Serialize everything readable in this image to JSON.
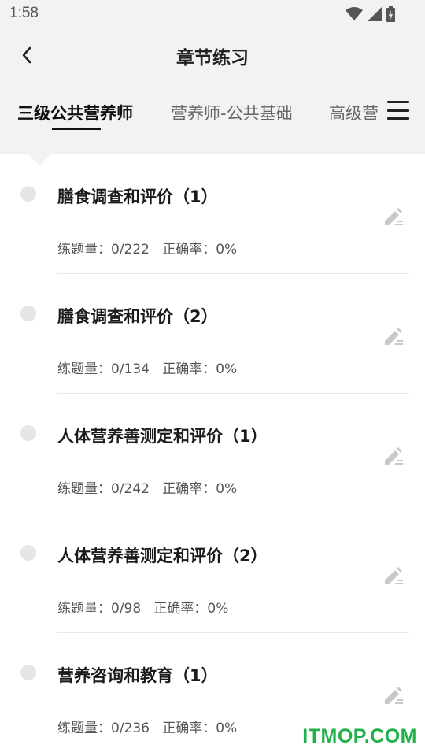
{
  "status_bar": {
    "time": "1:58"
  },
  "header": {
    "title": "章节练习"
  },
  "tabs": [
    {
      "label": "三级公共营养师",
      "active": true
    },
    {
      "label": "营养师-公共基础",
      "active": false
    },
    {
      "label": "高级营养师",
      "active": false
    }
  ],
  "stat_labels": {
    "count": "练题量：",
    "accuracy": "正确率："
  },
  "chapters": [
    {
      "title": "膳食调查和评价（1）",
      "count": "0/222",
      "accuracy": "0%"
    },
    {
      "title": "膳食调查和评价（2）",
      "count": "0/134",
      "accuracy": "0%"
    },
    {
      "title": "人体营养善测定和评价（1）",
      "count": "0/242",
      "accuracy": "0%"
    },
    {
      "title": "人体营养善测定和评价（2）",
      "count": "0/98",
      "accuracy": "0%"
    },
    {
      "title": "营养咨询和教育（1）",
      "count": "0/236",
      "accuracy": "0%"
    }
  ],
  "watermark": "ITMOP.COM",
  "colors": {
    "header_bg": "#f2f2f2",
    "dot": "#e6e6e6",
    "watermark": "#22b04b",
    "icon": "#c8c8c8"
  },
  "icons": {
    "back": "chevron-left-icon",
    "menu": "hamburger-menu-icon",
    "edit": "pencil-edit-icon"
  }
}
